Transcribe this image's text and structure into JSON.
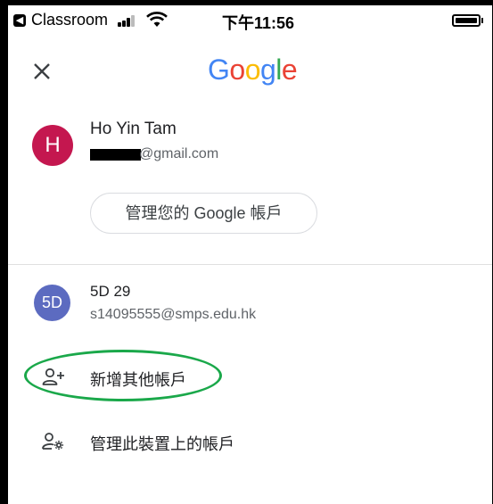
{
  "status_bar": {
    "back_app": "Classroom",
    "time": "下午11:56"
  },
  "header": {
    "logo_text": "Google",
    "logo_colors": [
      "#4285F4",
      "#EA4335",
      "#FBBC05",
      "#4285F4",
      "#34A853",
      "#EA4335"
    ]
  },
  "primary_account": {
    "avatar_letter": "H",
    "avatar_color": "#c4174f",
    "name": "Ho Yin Tam",
    "email_visible": "@gmail.com",
    "manage_button": "管理您的 Google 帳戶"
  },
  "secondary_account": {
    "avatar_text": "5D",
    "avatar_color": "#5c6bc0",
    "name": "5D 29",
    "email": "s14095555@smps.edu.hk"
  },
  "menu": {
    "add_account": "新增其他帳戶",
    "manage_device_accounts": "管理此裝置上的帳戶"
  },
  "annotation": {
    "highlight_color": "#1aa84a"
  }
}
